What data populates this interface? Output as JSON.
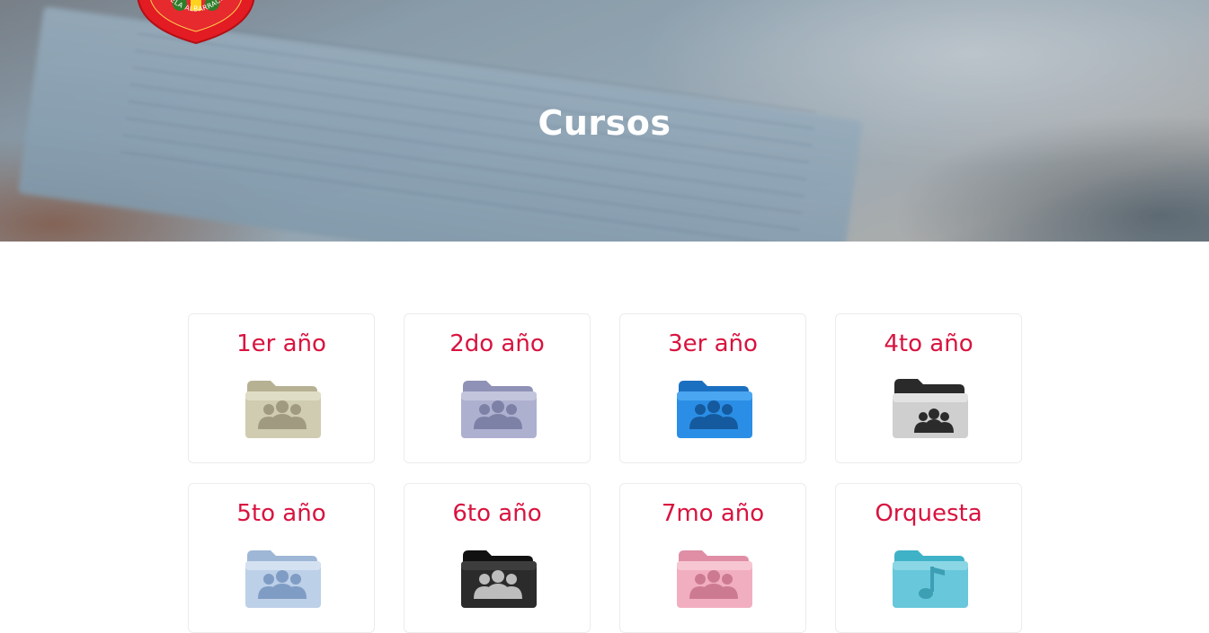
{
  "hero": {
    "title": "Cursos",
    "logo_text": "ESCUELA ALBARRACÍN DE SARMIENTO"
  },
  "courses": [
    {
      "label": "1er año",
      "icon": "people-folder-icon",
      "color": "#c7c3a6"
    },
    {
      "label": "2do año",
      "icon": "people-folder-icon",
      "color": "#a9abcc"
    },
    {
      "label": "3er año",
      "icon": "people-folder-icon",
      "color": "#2f8fe0"
    },
    {
      "label": "4to año",
      "icon": "people-folder-icon",
      "color": "#c9c9c9"
    },
    {
      "label": "5to año",
      "icon": "people-folder-icon",
      "color": "#b9cde6"
    },
    {
      "label": "6to año",
      "icon": "people-folder-icon",
      "color": "#2a2a2a"
    },
    {
      "label": "7mo año",
      "icon": "people-folder-icon",
      "color": "#f0a9bd"
    },
    {
      "label": "Orquesta",
      "icon": "music-folder-icon",
      "color": "#67c6d9"
    }
  ],
  "accent_color": "#d8133f"
}
